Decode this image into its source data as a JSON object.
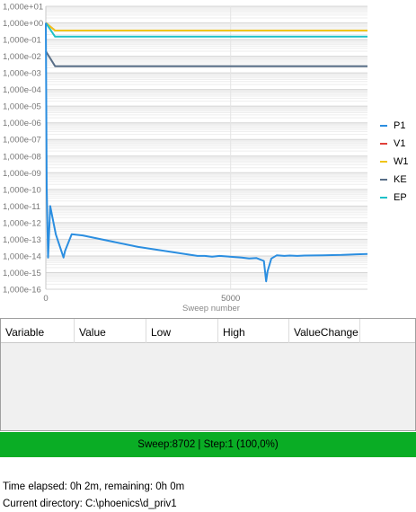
{
  "chart_data": {
    "type": "line",
    "xlabel": "Sweep number",
    "ylabel": "",
    "yscale": "log",
    "xlim": [
      0,
      8702
    ],
    "ylim": [
      1e-16,
      10
    ],
    "x_ticks": [
      "0",
      "5000"
    ],
    "x_tick_values": [
      0,
      5000
    ],
    "y_tick_labels": [
      "1,000e+01",
      "1,000e+00",
      "1,000e-01",
      "1,000e-02",
      "1,000e-03",
      "1,000e-04",
      "1,000e-05",
      "1,000e-06",
      "1,000e-07",
      "1,000e-08",
      "1,000e-09",
      "1,000e-10",
      "1,000e-11",
      "1,000e-12",
      "1,000e-13",
      "1,000e-14",
      "1,000e-15",
      "1,000e-16"
    ],
    "y_tick_exponents": [
      1,
      0,
      -1,
      -2,
      -3,
      -4,
      -5,
      -6,
      -7,
      -8,
      -9,
      -10,
      -11,
      -12,
      -13,
      -14,
      -15,
      -16
    ],
    "grid": true,
    "legend_position": "right",
    "series": [
      {
        "name": "P1",
        "color": "#2b8ee0",
        "x": [
          0,
          25,
          60,
          120,
          270,
          480,
          520,
          700,
          1000,
          2500,
          4100,
          4300,
          4500,
          4700,
          5300,
          5500,
          5700,
          5900,
          5960,
          6000,
          6100,
          6250,
          6450,
          6600,
          6800,
          7000,
          7500,
          8000,
          8400,
          8702
        ],
        "y": [
          1,
          1e-10,
          8e-15,
          1e-11,
          2e-13,
          8e-15,
          2e-14,
          2e-13,
          1.7e-13,
          3.5e-14,
          1e-14,
          1e-14,
          9e-15,
          1e-14,
          8e-15,
          7e-15,
          7.5e-15,
          5e-15,
          3e-16,
          1.2e-15,
          7e-15,
          1.1e-14,
          1e-14,
          1.05e-14,
          1e-14,
          1.05e-14,
          1.1e-14,
          1.15e-14,
          1.25e-14,
          1.3e-14
        ]
      },
      {
        "name": "V1",
        "color": "#e0413a",
        "x": [
          0,
          250,
          8702
        ],
        "y": [
          1,
          0.35,
          0.35
        ]
      },
      {
        "name": "W1",
        "color": "#f0c419",
        "x": [
          0,
          250,
          8702
        ],
        "y": [
          1,
          0.35,
          0.35
        ]
      },
      {
        "name": "KE",
        "color": "#586e87",
        "x": [
          0,
          250,
          8702
        ],
        "y": [
          0.02,
          0.0025,
          0.0025
        ]
      },
      {
        "name": "EP",
        "color": "#1dc0c8",
        "x": [
          0,
          250,
          8702
        ],
        "y": [
          1,
          0.15,
          0.15
        ]
      }
    ]
  },
  "table": {
    "columns": [
      "Variable",
      "Value",
      "Low",
      "High",
      "ValueChange"
    ],
    "rows": []
  },
  "status": {
    "text": "Sweep:8702 | Step:1  (100,0%)",
    "color": "#0aad25"
  },
  "footer": {
    "time_elapsed": "Time elapsed: 0h 2m, remaining: 0h 0m",
    "current_directory": "Current directory:  C:\\phoenics\\d_priv1"
  }
}
